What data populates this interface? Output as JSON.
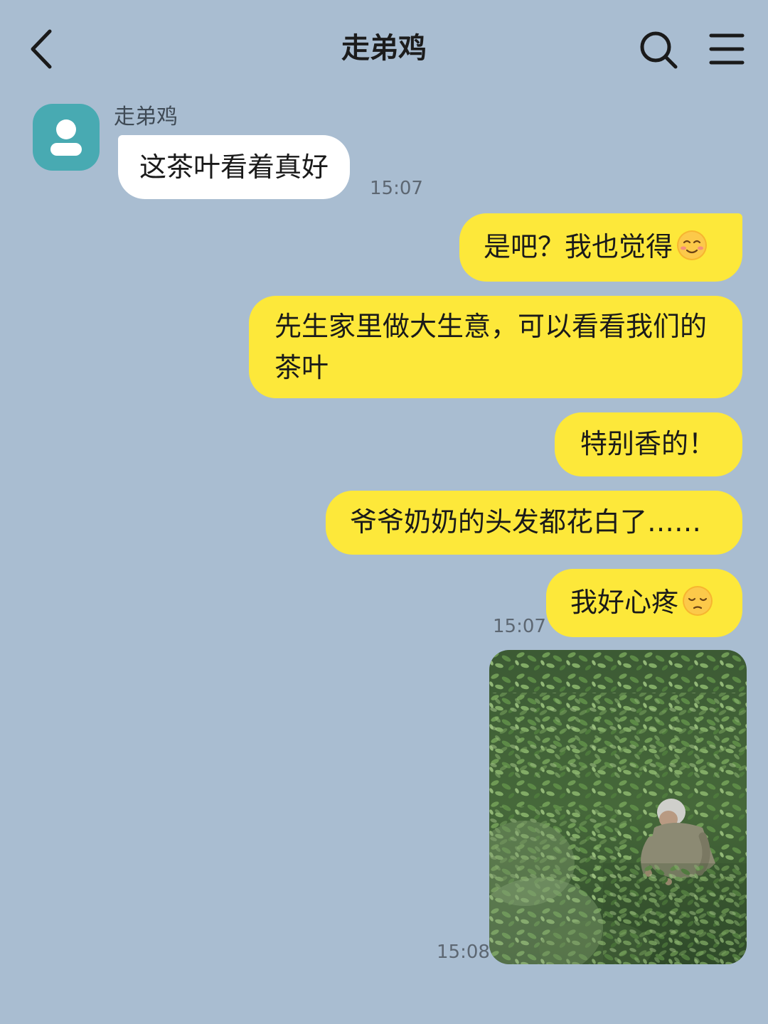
{
  "header": {
    "title": "走弟鸡"
  },
  "incoming": {
    "sender_name": "走弟鸡",
    "message": "这茶叶看着真好",
    "time": "15:07"
  },
  "outgoing": {
    "messages": [
      "是吧？我也觉得",
      "先生家里做大生意，可以看看我们的茶叶",
      "特别香的！",
      "爷爷奶奶的头发都花白了……",
      "我好心疼"
    ],
    "time_1": "15:07",
    "photo_time": "15:08"
  },
  "colors": {
    "background": "#a9bdd1",
    "outgoing_bubble": "#fde83a",
    "incoming_bubble": "#ffffff",
    "avatar": "#48aab2"
  },
  "icons": {
    "back": "chevron-left-icon",
    "search": "search-icon",
    "menu": "menu-icon",
    "emoji_smile": "smiling-face-icon",
    "emoji_pensive": "pensive-face-icon"
  }
}
